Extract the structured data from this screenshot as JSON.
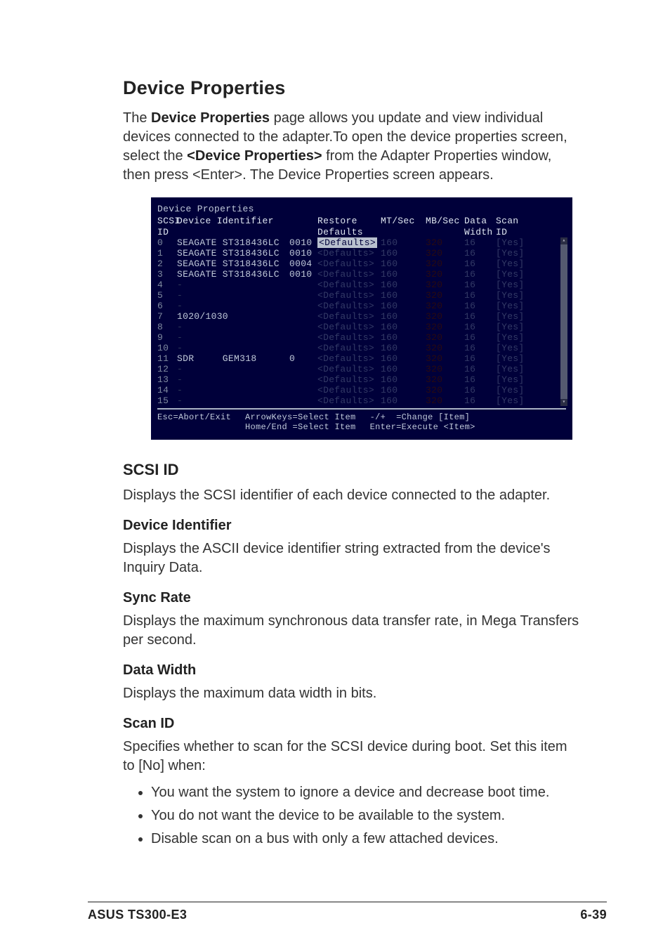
{
  "title": "Device Properties",
  "intro_parts": {
    "a": "The ",
    "b": "Device Properties",
    "c": " page allows you update and view individual devices connected to the adapter.To open the device properties screen, select the ",
    "d": "<Device Properties>",
    "e": " from the Adapter Properties window, then press <Enter>. The Device Properties screen appears."
  },
  "screenshot": {
    "title": "Device Properties",
    "headers": {
      "scsi_top": "SCSI",
      "scsi_bot": "ID",
      "dev": "Device Identifier",
      "restore_top": "Restore",
      "restore_bot": "Defaults",
      "mt": "MT/Sec",
      "mb": "MB/Sec",
      "dw_top": "Data",
      "dw_bot": "Width",
      "scan_top": "Scan",
      "scan_bot": "ID"
    },
    "rows": [
      {
        "id": "0",
        "dev": "SEAGATE ST318436LC",
        "num": "0010",
        "rest": "<Defaults>",
        "active": true,
        "mt": "160 ",
        "mb": "320",
        "dw": "16 ",
        "scan": "[Yes]"
      },
      {
        "id": "1",
        "dev": "SEAGATE ST318436LC",
        "num": "0010",
        "rest": "<Defaults>",
        "active": false,
        "mt": "160 ",
        "mb": "320",
        "dw": "16 ",
        "scan": "[Yes]"
      },
      {
        "id": "2",
        "dev": "SEAGATE ST318436LC",
        "num": "0004",
        "rest": "<Defaults>",
        "active": false,
        "mt": "160 ",
        "mb": "320",
        "dw": "16 ",
        "scan": "[Yes]"
      },
      {
        "id": "3",
        "dev": "SEAGATE ST318436LC",
        "num": "0010",
        "rest": "<Defaults>",
        "active": false,
        "mt": "160 ",
        "mb": "320",
        "dw": "16 ",
        "scan": "[Yes]"
      },
      {
        "id": "4",
        "dev": "-",
        "num": "",
        "rest": "<Defaults>",
        "active": false,
        "mt": "160 ",
        "mb": "320",
        "dw": "16 ",
        "scan": "[Yes]"
      },
      {
        "id": "5",
        "dev": "-",
        "num": "",
        "rest": "<Defaults>",
        "active": false,
        "mt": "160 ",
        "mb": "320",
        "dw": "16 ",
        "scan": "[Yes]"
      },
      {
        "id": "6",
        "dev": "-",
        "num": "",
        "rest": "<Defaults>",
        "active": false,
        "mt": "160 ",
        "mb": "320",
        "dw": "16 ",
        "scan": "[Yes]"
      },
      {
        "id": "7",
        "dev": "1020/1030",
        "num": "",
        "rest": "<Defaults>",
        "active": false,
        "mt": "160 ",
        "mb": "320",
        "dw": "16 ",
        "scan": "[Yes]"
      },
      {
        "id": "8",
        "dev": "-",
        "num": "",
        "rest": "<Defaults>",
        "active": false,
        "mt": "160 ",
        "mb": "320",
        "dw": "16 ",
        "scan": "[Yes]"
      },
      {
        "id": "9",
        "dev": "-",
        "num": "",
        "rest": "<Defaults>",
        "active": false,
        "mt": "160 ",
        "mb": "320",
        "dw": "16 ",
        "scan": "[Yes]"
      },
      {
        "id": "10",
        "dev": "-",
        "num": "",
        "rest": "<Defaults>",
        "active": false,
        "mt": "160 ",
        "mb": "320",
        "dw": "16 ",
        "scan": "[Yes]"
      },
      {
        "id": "11",
        "dev": "SDR     GEM318",
        "num": "0",
        "rest": "<Defaults>",
        "active": false,
        "mt": "160 ",
        "mb": "320",
        "dw": "16 ",
        "scan": "[Yes]"
      },
      {
        "id": "12",
        "dev": "-",
        "num": "",
        "rest": "<Defaults>",
        "active": false,
        "mt": "160 ",
        "mb": "320",
        "dw": "16 ",
        "scan": "[Yes]"
      },
      {
        "id": "13",
        "dev": "-",
        "num": "",
        "rest": "<Defaults>",
        "active": false,
        "mt": "160 ",
        "mb": "320",
        "dw": "16 ",
        "scan": "[Yes]"
      },
      {
        "id": "14",
        "dev": "-",
        "num": "",
        "rest": "<Defaults>",
        "active": false,
        "mt": "160 ",
        "mb": "320",
        "dw": "16 ",
        "scan": "[Yes]"
      },
      {
        "id": "15",
        "dev": "-",
        "num": "",
        "rest": "<Defaults>",
        "active": false,
        "mt": "160 ",
        "mb": "320",
        "dw": "16 ",
        "scan": "[Yes]"
      }
    ],
    "footer": {
      "esc": "Esc=Abort/Exit",
      "arrows": "ArrowKeys=Select Item",
      "home": "Home/End =Select Item",
      "plusminus": "-/+  =Change [Item]",
      "enter": "Enter=Execute <Item>"
    }
  },
  "sections": {
    "scsi_id": {
      "h": "SCSI ID",
      "p": "Displays the SCSI identifier of each device connected to the adapter."
    },
    "device_identifier": {
      "h": "Device Identifier",
      "p": "Displays the ASCII device identifier string extracted from the device's Inquiry Data."
    },
    "sync_rate": {
      "h": "Sync Rate",
      "p": "Displays the maximum synchronous data transfer rate, in Mega Transfers per second."
    },
    "data_width": {
      "h": "Data Width",
      "p": "Displays the maximum data width in bits."
    },
    "scan_id": {
      "h": "Scan ID",
      "p": "Specifies whether to scan for the SCSI device during boot. Set this item to [No] when:",
      "bullets": [
        "You want the system to ignore a device and decrease boot time.",
        "You do not want the device to be available to the system.",
        "Disable scan on a bus with only a few attached devices."
      ]
    }
  },
  "footer": {
    "left": "ASUS TS300-E3",
    "right": "6-39"
  }
}
